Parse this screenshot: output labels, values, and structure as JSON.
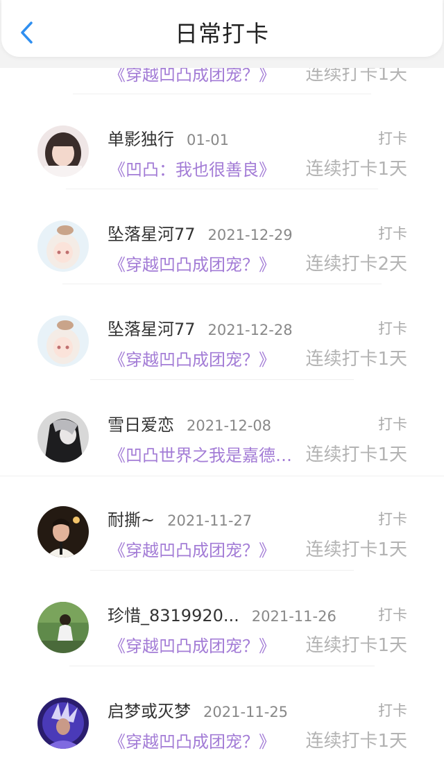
{
  "header": {
    "title": "日常打卡",
    "back_icon": "chevron-left-icon",
    "accent": "#2f8ff0"
  },
  "colors": {
    "book_title": "#a37cd6",
    "streak": "#b3b3b3",
    "date": "#888888"
  },
  "partial_row": {
    "book": "《穿越凹凸成团宠？》",
    "streak": "连续打卡1天"
  },
  "entries": [
    {
      "name": "单影独行",
      "date": "01-01",
      "label": "打卡",
      "book": "《凹凸：我也很善良》",
      "streak": "连续打卡1天"
    },
    {
      "name": "坠落星河77",
      "date": "2021-12-29",
      "label": "打卡",
      "book": "《穿越凹凸成团宠？》",
      "streak": "连续打卡2天"
    },
    {
      "name": "坠落星河77",
      "date": "2021-12-28",
      "label": "打卡",
      "book": "《穿越凹凸成团宠？》",
      "streak": "连续打卡1天"
    },
    {
      "name": "雪日爱恋",
      "date": "2021-12-08",
      "label": "打卡",
      "book": "《凹凸世界之我是嘉德罗...",
      "streak": "连续打卡1天"
    },
    {
      "name": "耐撕~",
      "date": "2021-11-27",
      "label": "打卡",
      "book": "《穿越凹凸成团宠？》",
      "streak": "连续打卡1天"
    },
    {
      "name": "珍惜_8319920...",
      "date": "2021-11-26",
      "label": "打卡",
      "book": "《穿越凹凸成团宠？》",
      "streak": "连续打卡1天"
    },
    {
      "name": "启梦或灭梦",
      "date": "2021-11-25",
      "label": "打卡",
      "book": "《穿越凹凸成团宠？》",
      "streak": "连续打卡1天"
    }
  ]
}
